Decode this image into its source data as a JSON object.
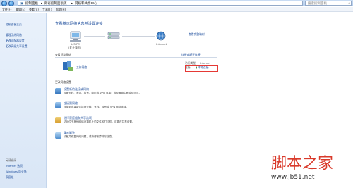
{
  "address": {
    "back_icon": "back-arrow-icon",
    "forward_icon": "forward-arrow-icon",
    "crumbs": [
      "控制面板",
      "所有控制面板项",
      "网络和共享中心"
    ],
    "search_placeholder": "搜索控制面板"
  },
  "menu": [
    "文件(F)",
    "编辑(E)",
    "查看(V)",
    "工具(T)",
    "帮助(H)"
  ],
  "sidebar": {
    "items": [
      "控制面板主页",
      "管理无线网络",
      "更改适配器设置",
      "更改高级共享设置"
    ],
    "see_also_title": "另请参阅",
    "see_also": [
      "Internet 选项",
      "Windows 防火墙",
      "家庭组"
    ]
  },
  "main": {
    "title": "查看基本网络信息并设置连接",
    "full_map_link": "查看完整映射",
    "map": {
      "computer_name": "LJS-PC",
      "computer_sub": "(此计算机)",
      "internet_label": "Internet"
    },
    "active_networks_title": "查看活动网络",
    "connect_disconnect_link": "连接或断开连接",
    "network": {
      "type_label": "工作网络",
      "access_type_key": "访问类型:",
      "access_type_value": "Internet",
      "connections_key": "连接:",
      "connections_value": "本地连接"
    },
    "change_settings_title": "更改网络设置",
    "tasks": [
      {
        "title": "设置新的连接或网络",
        "desc": "设置无线、宽带、拨号、临时或 VPN 连接；或设置路由器或访问点。"
      },
      {
        "title": "连接到网络",
        "desc": "连接到或重新连接到无线、有线、拨号或 VPN 网络连接。"
      },
      {
        "title": "选择家庭组和共享选项",
        "desc": "访问位于其他网络计算机上的文件和打印机，或更改共享设置。"
      },
      {
        "title": "疑难解答",
        "desc": "诊断并修复网络问题，或获得故障排除信息。"
      }
    ]
  },
  "watermark": {
    "title": "脚本之家",
    "url": "www.jb51.net"
  },
  "colors": {
    "link": "#1e4e9c",
    "highlight": "#e53935",
    "watermark": "#d93a2b"
  }
}
